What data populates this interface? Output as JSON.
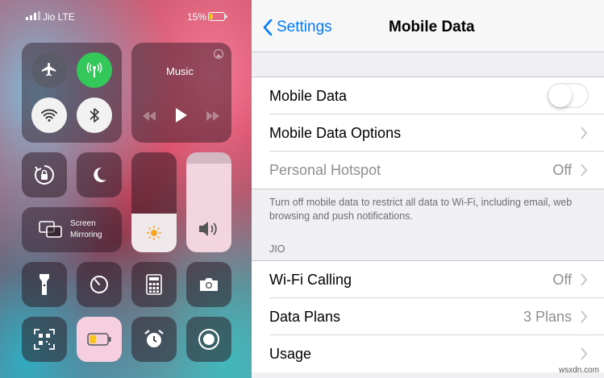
{
  "control_center": {
    "carrier": "Jio LTE",
    "battery": "15%",
    "music_label": "Music",
    "screen_mirroring_line1": "Screen",
    "screen_mirroring_line2": "Mirroring",
    "colors": {
      "green": "#34c759",
      "battery_low": "#f5c51d"
    }
  },
  "settings": {
    "back_label": "Settings",
    "title": "Mobile Data",
    "rows": [
      {
        "label": "Mobile Data",
        "value": ""
      },
      {
        "label": "Mobile Data Options",
        "value": ""
      },
      {
        "label": "Personal Hotspot",
        "value": "Off"
      }
    ],
    "footer_note": "Turn off mobile data to restrict all data to Wi-Fi, including email, web browsing and push notifications.",
    "section_header": "JIO",
    "carrier_rows": [
      {
        "label": "Wi-Fi Calling",
        "value": "Off"
      },
      {
        "label": "Data Plans",
        "value": "3 Plans"
      },
      {
        "label": "Usage",
        "value": ""
      }
    ],
    "accent": "#007aff"
  },
  "watermark": "wsxdn.com"
}
